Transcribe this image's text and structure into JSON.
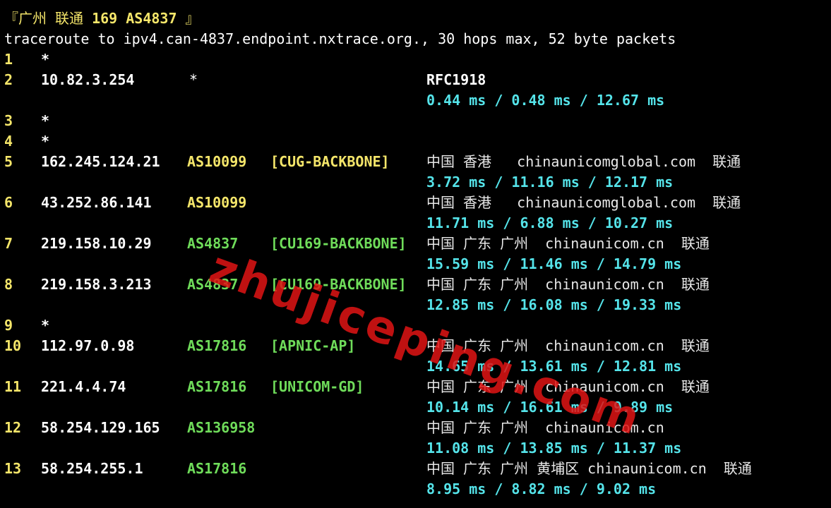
{
  "title": {
    "prefix": "『广州 联通 ",
    "highlight": "169 AS4837",
    "suffix": " 』"
  },
  "command": "traceroute to ipv4.can-4837.endpoint.nxtrace.org., 30 hops max, 52 byte packets",
  "watermark": "zhujiceping.com",
  "colors": {
    "yellow": "#f5e66a",
    "green": "#6fdc5a",
    "cyan": "#55e4ea",
    "watermark": "#e11414"
  },
  "hops": [
    {
      "n": "1",
      "ip": "*"
    },
    {
      "n": "2",
      "ip": "10.82.3.254",
      "asn": "*",
      "asn_color": "white",
      "geo": "RFC1918",
      "geo_bold": true,
      "rtt": "0.44 ms / 0.48 ms / 12.67 ms"
    },
    {
      "n": "3",
      "ip": "*"
    },
    {
      "n": "4",
      "ip": "*"
    },
    {
      "n": "5",
      "ip": "162.245.124.21",
      "asn": "AS10099",
      "asn_color": "yellow",
      "tag": "[CUG-BACKBONE]",
      "tag_color": "yellow",
      "geo": "中国 香港   chinaunicomglobal.com  联通",
      "rtt": "3.72 ms / 11.16 ms / 12.17 ms"
    },
    {
      "n": "6",
      "ip": "43.252.86.141",
      "asn": "AS10099",
      "asn_color": "yellow",
      "geo": "中国 香港   chinaunicomglobal.com  联通",
      "rtt": "11.71 ms / 6.88 ms / 10.27 ms"
    },
    {
      "n": "7",
      "ip": "219.158.10.29",
      "asn": "AS4837",
      "asn_color": "green",
      "tag": "[CU169-BACKBONE]",
      "tag_color": "green",
      "geo": "中国 广东 广州  chinaunicom.cn  联通",
      "rtt": "15.59 ms / 11.46 ms / 14.79 ms"
    },
    {
      "n": "8",
      "ip": "219.158.3.213",
      "asn": "AS4837",
      "asn_color": "green",
      "tag": "[CU169-BACKBONE]",
      "tag_color": "green",
      "geo": "中国 广东 广州  chinaunicom.cn  联通",
      "rtt": "12.85 ms / 16.08 ms / 19.33 ms"
    },
    {
      "n": "9",
      "ip": "*"
    },
    {
      "n": "10",
      "ip": "112.97.0.98",
      "asn": "AS17816",
      "asn_color": "green",
      "tag": "[APNIC-AP]",
      "tag_color": "green",
      "geo": "中国 广东 广州  chinaunicom.cn  联通",
      "rtt": "14.65 ms / 13.61 ms / 12.81 ms"
    },
    {
      "n": "11",
      "ip": "221.4.4.74",
      "asn": "AS17816",
      "asn_color": "green",
      "tag": "[UNICOM-GD]",
      "tag_color": "green",
      "geo": "中国 广东 广州  chinaunicom.cn  联通",
      "rtt": "10.14 ms / 16.61 ms / 9.89 ms"
    },
    {
      "n": "12",
      "ip": "58.254.129.165",
      "asn": "AS136958",
      "asn_color": "green",
      "geo": "中国 广东 广州  chinaunicom.cn",
      "rtt": "11.08 ms / 13.85 ms / 11.37 ms"
    },
    {
      "n": "13",
      "ip": "58.254.255.1",
      "asn": "AS17816",
      "asn_color": "green",
      "geo": "中国 广东 广州 黄埔区 chinaunicom.cn  联通",
      "rtt": "8.95 ms / 8.82 ms / 9.02 ms"
    }
  ]
}
